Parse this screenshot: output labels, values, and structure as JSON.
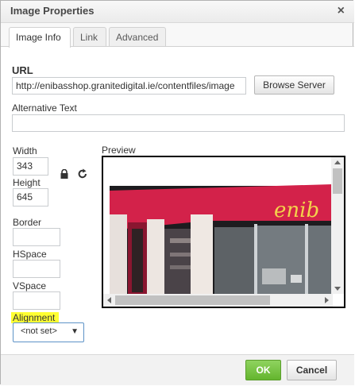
{
  "dialog": {
    "title": "Image Properties",
    "close_label": "×"
  },
  "tabs": [
    {
      "label": "Image Info",
      "active": true
    },
    {
      "label": "Link",
      "active": false
    },
    {
      "label": "Advanced",
      "active": false
    }
  ],
  "url": {
    "label": "URL",
    "value": "http://enibasshop.granitedigital.ie/contentfiles/image",
    "browse_label": "Browse Server"
  },
  "alt_text": {
    "label": "Alternative Text",
    "value": ""
  },
  "width": {
    "label": "Width",
    "value": "343"
  },
  "height": {
    "label": "Height",
    "value": "645"
  },
  "border": {
    "label": "Border",
    "value": ""
  },
  "hspace": {
    "label": "HSpace",
    "value": ""
  },
  "vspace": {
    "label": "VSpace",
    "value": ""
  },
  "alignment": {
    "label": "Alignment",
    "selected": "<not set>",
    "highlight_color": "#ffff33"
  },
  "preview": {
    "label": "Preview",
    "sign_text": "enib",
    "sign_color": "#d3224a",
    "sign_text_color": "#f4d24b"
  },
  "icons": {
    "lock": "lock-icon",
    "reset": "reset-size-icon",
    "close": "close-icon",
    "dropdown": "chevron-down-icon"
  },
  "footer": {
    "ok_label": "OK",
    "cancel_label": "Cancel",
    "ok_color": "#64b52e"
  }
}
